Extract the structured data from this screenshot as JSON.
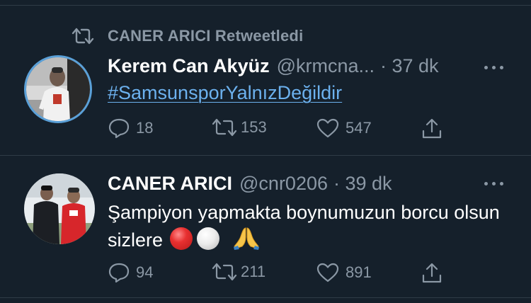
{
  "retweet_banner": {
    "text": "CANER ARICI Retweetledi"
  },
  "tweets": [
    {
      "name": "Kerem Can Akyüz",
      "handle": "@krmcna...",
      "time": "· 37 dk",
      "text": "#SamsunsporYalnızDeğildir",
      "replies": "18",
      "retweets": "153",
      "likes": "547"
    },
    {
      "name": "CANER ARICI",
      "handle": "@cnr0206",
      "time": "· 39 dk",
      "text": "Şampiyon yapmakta boynumuzun borcu olsun sizlere",
      "replies": "94",
      "retweets": "211",
      "likes": "891"
    }
  ],
  "colors": {
    "background": "#15202b",
    "secondary_text": "#8b98a5",
    "link": "#6cb1ee",
    "avatar_ring": "#5aa0d8"
  },
  "icons": [
    "retweet-icon",
    "more-icon",
    "reply-icon",
    "like-icon",
    "share-icon",
    "red-circle-emoji",
    "white-circle-emoji",
    "praying-hands-emoji"
  ]
}
